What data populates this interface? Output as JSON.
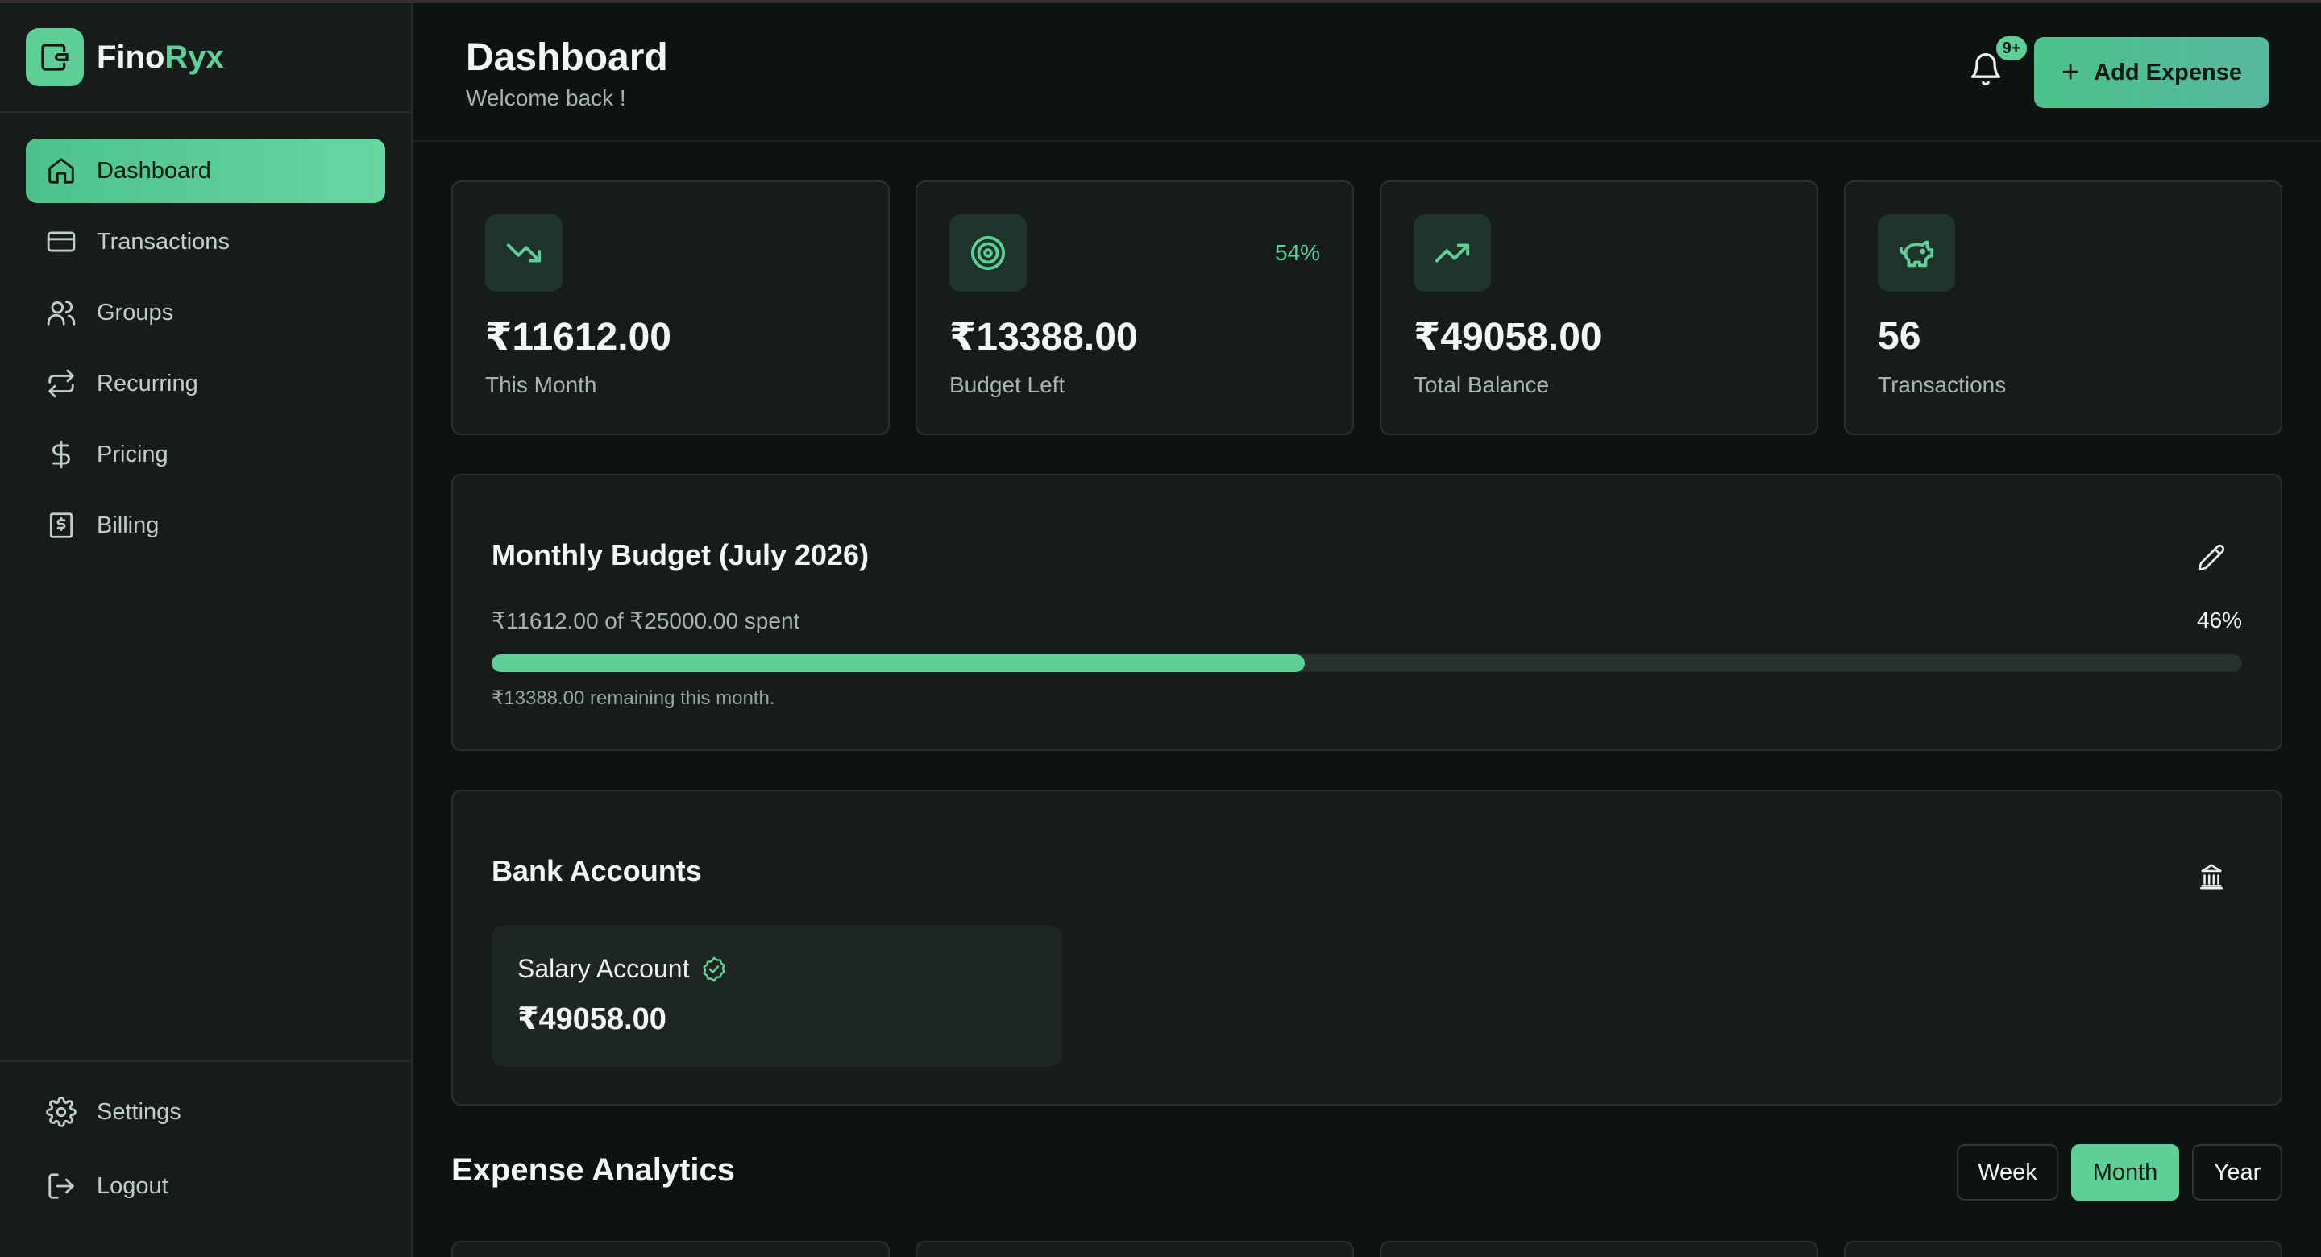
{
  "brand": {
    "name_part1": "Fino",
    "name_part2": "Ryx"
  },
  "sidebar": {
    "items": [
      {
        "label": "Dashboard",
        "icon": "home-icon",
        "active": true
      },
      {
        "label": "Transactions",
        "icon": "credit-card-icon"
      },
      {
        "label": "Groups",
        "icon": "users-icon"
      },
      {
        "label": "Recurring",
        "icon": "repeat-icon"
      },
      {
        "label": "Pricing",
        "icon": "dollar-icon"
      },
      {
        "label": "Billing",
        "icon": "receipt-icon"
      }
    ],
    "bottom": [
      {
        "label": "Settings",
        "icon": "gear-icon"
      },
      {
        "label": "Logout",
        "icon": "logout-icon"
      }
    ]
  },
  "header": {
    "title": "Dashboard",
    "subtitle": "Welcome back !",
    "notification_count": "9+",
    "add_button": "Add Expense"
  },
  "stats": [
    {
      "value": "₹11612.00",
      "label": "This Month",
      "icon": "trending-down-icon"
    },
    {
      "value": "₹13388.00",
      "label": "Budget Left",
      "icon": "target-icon",
      "percent": "54%"
    },
    {
      "value": "₹49058.00",
      "label": "Total Balance",
      "icon": "trending-up-icon"
    },
    {
      "value": "56",
      "label": "Transactions",
      "icon": "piggy-bank-icon"
    }
  ],
  "budget": {
    "title": "Monthly Budget (July 2026)",
    "spent_text": "₹11612.00 of ₹25000.00 spent",
    "percent_text": "46%",
    "progress": 0.4645,
    "remaining_text": "₹13388.00 remaining this month."
  },
  "bank": {
    "title": "Bank Accounts",
    "accounts": [
      {
        "name": "Salary Account",
        "balance": "₹49058.00",
        "verified": true
      }
    ]
  },
  "analytics": {
    "title": "Expense Analytics",
    "ranges": [
      "Week",
      "Month",
      "Year"
    ],
    "selected": "Month"
  },
  "colors": {
    "accent": "#5ecf97",
    "background": "#0c1311",
    "card": "#151c1a"
  }
}
